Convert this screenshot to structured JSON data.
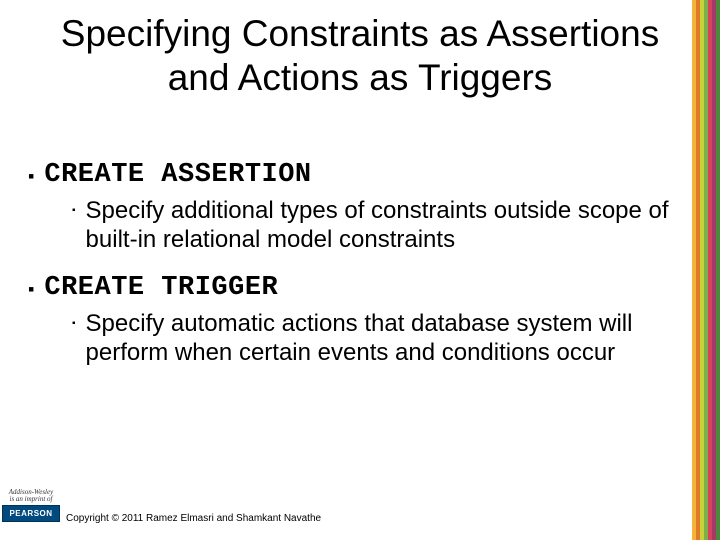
{
  "title": "Specifying Constraints as Assertions and Actions as Triggers",
  "bullets": [
    {
      "heading": "CREATE ASSERTION",
      "sub": "Specify additional types of constraints outside scope of built-in relational model constraints"
    },
    {
      "heading": "CREATE TRIGGER",
      "sub": "Specify automatic actions that database system will perform when certain events and conditions occur"
    }
  ],
  "logo": {
    "imprint_line1": "Addison-Wesley",
    "imprint_line2": "is an imprint of",
    "brand": "PEARSON"
  },
  "copyright": "Copyright © 2011 Ramez Elmasri and Shamkant Navathe"
}
